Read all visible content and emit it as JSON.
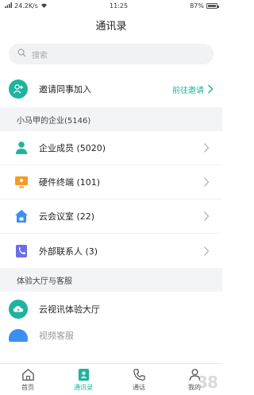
{
  "status_bar": {
    "speed": "24.2K/s",
    "time": "11:25",
    "battery": "87%"
  },
  "header": {
    "title": "通讯录"
  },
  "search": {
    "placeholder": "搜索"
  },
  "invite": {
    "label": "邀请同事加入",
    "link": "前往邀请"
  },
  "enterprise": {
    "section_title": "小马甲的企业(5146)",
    "items": [
      {
        "label": "企业成员 (5020)",
        "icon": "person-icon",
        "color": "#1fb3a0"
      },
      {
        "label": "硬件终端 (101)",
        "icon": "monitor-icon",
        "color": "#f59b23"
      },
      {
        "label": "云会议室 (22)",
        "icon": "house-icon",
        "color": "#3a8ff0"
      },
      {
        "label": "外部联系人 (3)",
        "icon": "phone-icon",
        "color": "#6b6fe3"
      }
    ]
  },
  "experience": {
    "section_title": "体验大厅与客服",
    "items": [
      {
        "label": "云视讯体验大厅"
      },
      {
        "label": "视频客服"
      }
    ]
  },
  "tabbar": {
    "tabs": [
      {
        "label": "首页",
        "active": false
      },
      {
        "label": "通讯录",
        "active": true
      },
      {
        "label": "通话",
        "active": false
      },
      {
        "label": "我的",
        "active": false
      }
    ]
  },
  "colors": {
    "accent": "#1fb3a0"
  },
  "watermark": "38"
}
